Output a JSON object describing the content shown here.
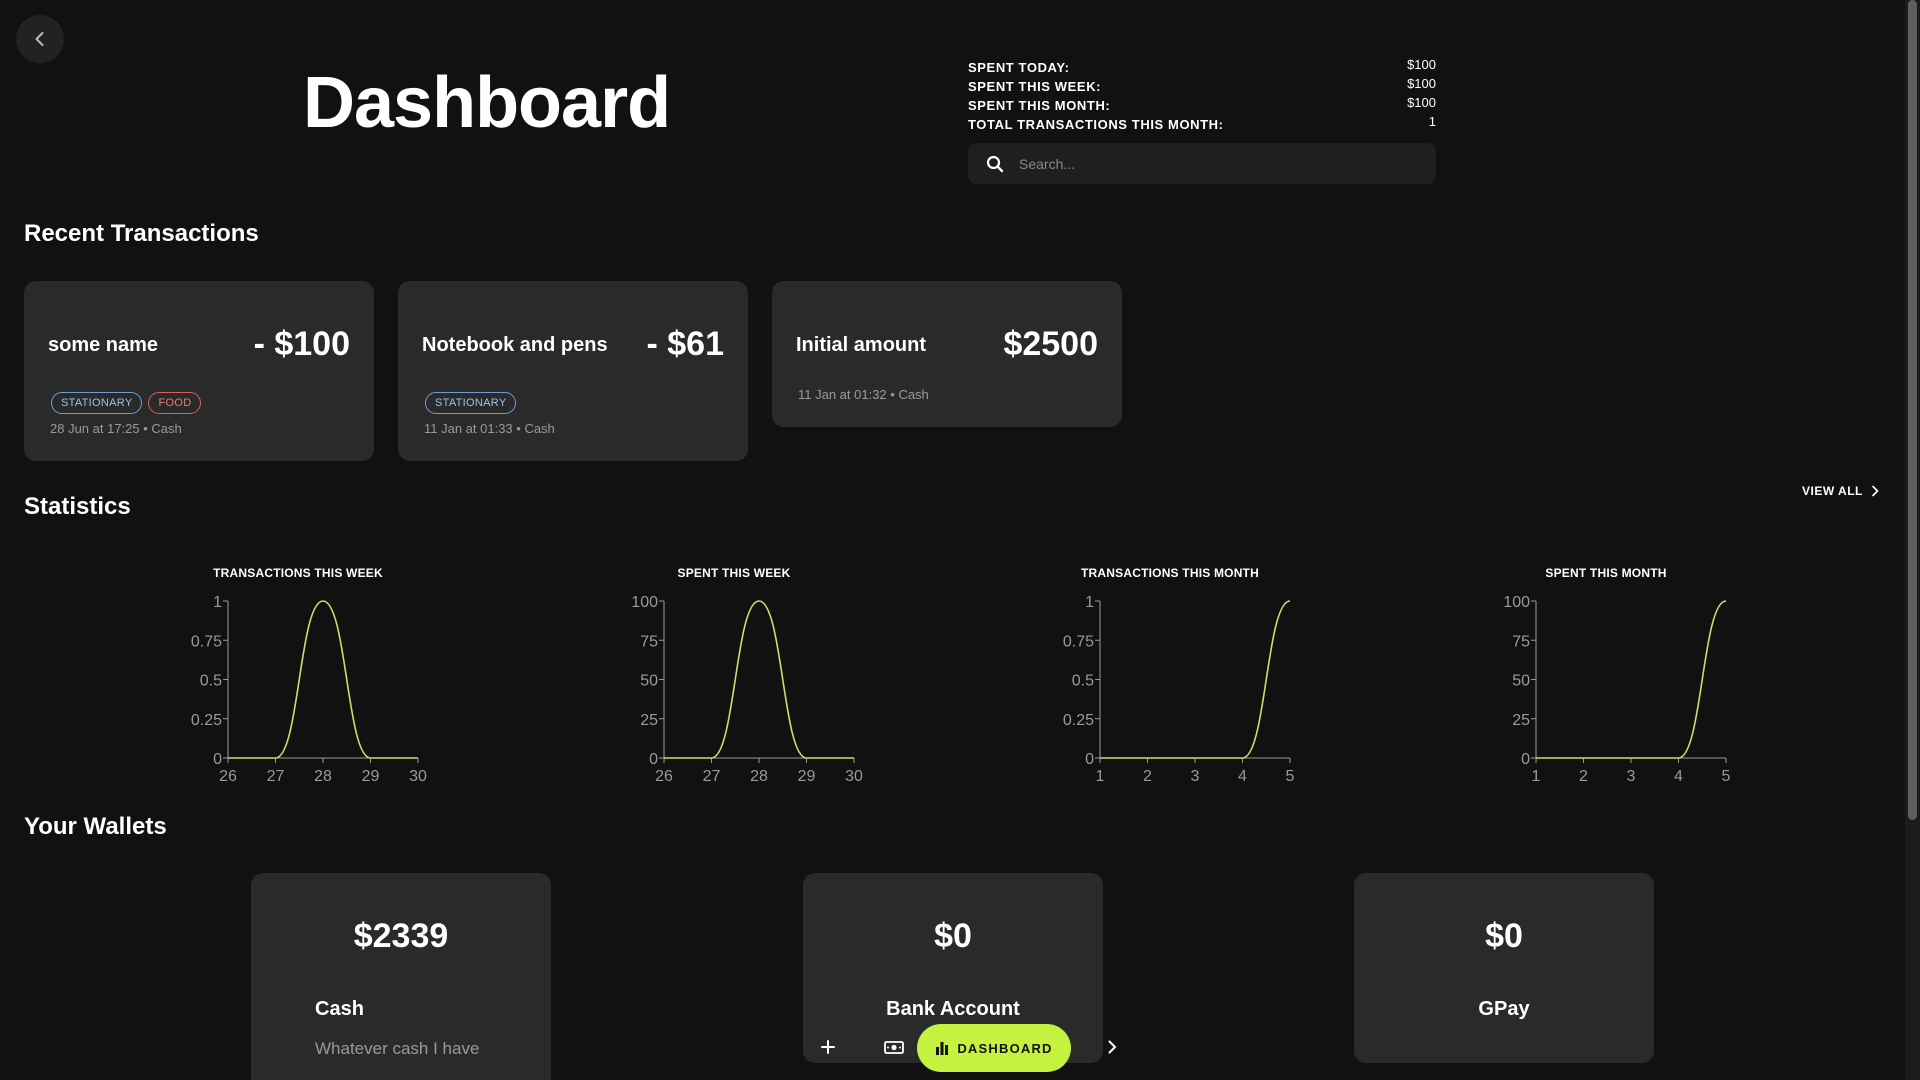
{
  "header": {
    "title": "Dashboard",
    "summary": [
      {
        "label": "SPENT TODAY:",
        "value": "$100"
      },
      {
        "label": "SPENT THIS WEEK:",
        "value": "$100"
      },
      {
        "label": "SPENT THIS MONTH:",
        "value": "$100"
      },
      {
        "label": "TOTAL TRANSACTIONS THIS MONTH:",
        "value": "1"
      }
    ],
    "search": {
      "placeholder": "Search..."
    }
  },
  "recent": {
    "title": "Recent Transactions",
    "items": [
      {
        "name": "some name",
        "amount": "- $100",
        "tags": [
          "STATIONARY",
          "FOOD"
        ],
        "meta": "28 Jun at 17:25 • Cash"
      },
      {
        "name": "Notebook and pens",
        "amount": "- $61",
        "tags": [
          "STATIONARY"
        ],
        "meta": "11 Jan at 01:33 • Cash"
      },
      {
        "name": "Initial amount",
        "amount": "$2500",
        "tags": [],
        "meta": "11 Jan at 01:32 • Cash"
      }
    ]
  },
  "statistics": {
    "title": "Statistics",
    "view_all": "VIEW ALL"
  },
  "chart_data": [
    {
      "type": "line",
      "title": "TRANSACTIONS THIS WEEK",
      "x": [
        26,
        27,
        28,
        29,
        30
      ],
      "series": [
        {
          "values": [
            0,
            0,
            1,
            0,
            0
          ]
        }
      ],
      "ylim": [
        0,
        1
      ],
      "yticks": [
        "0",
        "0.25",
        "0.5",
        "0.75",
        "1"
      ],
      "xticks": [
        "26",
        "27",
        "28",
        "29",
        "30"
      ],
      "color": "#c8e06a"
    },
    {
      "type": "line",
      "title": "SPENT THIS WEEK",
      "x": [
        26,
        27,
        28,
        29,
        30
      ],
      "series": [
        {
          "values": [
            0,
            0,
            100,
            0,
            0
          ]
        }
      ],
      "ylim": [
        0,
        100
      ],
      "yticks": [
        "0",
        "25",
        "50",
        "75",
        "100"
      ],
      "xticks": [
        "26",
        "27",
        "28",
        "29",
        "30"
      ],
      "color": "#c8e06a"
    },
    {
      "type": "line",
      "title": "TRANSACTIONS THIS MONTH",
      "x": [
        1,
        2,
        3,
        4,
        5
      ],
      "series": [
        {
          "values": [
            0,
            0,
            0,
            0,
            1
          ]
        }
      ],
      "ylim": [
        0,
        1
      ],
      "yticks": [
        "0",
        "0.25",
        "0.5",
        "0.75",
        "1"
      ],
      "xticks": [
        "1",
        "2",
        "3",
        "4",
        "5"
      ],
      "color": "#c8e06a"
    },
    {
      "type": "line",
      "title": "SPENT THIS MONTH",
      "x": [
        1,
        2,
        3,
        4,
        5
      ],
      "series": [
        {
          "values": [
            0,
            0,
            0,
            0,
            100
          ]
        }
      ],
      "ylim": [
        0,
        100
      ],
      "yticks": [
        "0",
        "25",
        "50",
        "75",
        "100"
      ],
      "xticks": [
        "1",
        "2",
        "3",
        "4",
        "5"
      ],
      "color": "#c8e06a"
    }
  ],
  "wallets": {
    "title": "Your Wallets",
    "items": [
      {
        "amount": "$2339",
        "name": "Cash",
        "desc": "Whatever cash I have"
      },
      {
        "amount": "$0",
        "name": "Bank Account",
        "desc": ""
      },
      {
        "amount": "$0",
        "name": "GPay",
        "desc": ""
      }
    ]
  },
  "nav": {
    "dashboard_label": "DASHBOARD",
    "accent": "#c4f23f"
  }
}
